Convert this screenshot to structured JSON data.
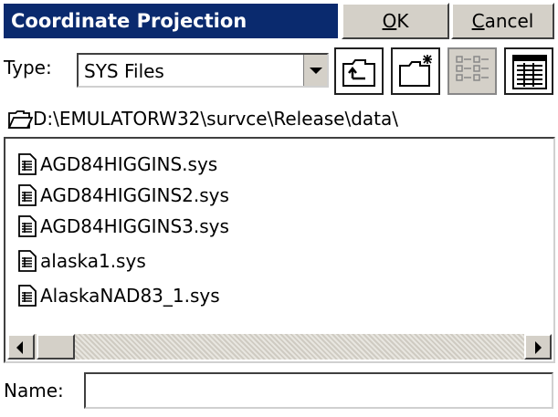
{
  "window": {
    "title": "Coordinate Projection",
    "ok_label_pre": "",
    "ok_label_u": "O",
    "ok_label_post": "K",
    "cancel_label_u": "C",
    "cancel_label_post": "ancel"
  },
  "type_row": {
    "label": "Type:",
    "selected": "SYS Files"
  },
  "toolbar_icons": [
    "up-folder-icon",
    "new-folder-icon",
    "list-view-icon",
    "details-view-icon"
  ],
  "path": {
    "icon": "folder-open-icon",
    "text": "D:\\EMULATORW32\\survce\\Release\\data\\"
  },
  "files": [
    {
      "name": "AGD84HIGGINS.sys",
      "icon": "sys-file-icon"
    },
    {
      "name": "AGD84HIGGINS2.sys",
      "icon": "sys-file-icon"
    },
    {
      "name": "AGD84HIGGINS3.sys",
      "icon": "sys-file-icon"
    },
    {
      "name": "alaska1.sys",
      "icon": "sys-file-icon"
    },
    {
      "name": "AlaskaNAD83_1.sys",
      "icon": "sys-file-icon"
    }
  ],
  "name_row": {
    "label": "Name:",
    "value": ""
  }
}
